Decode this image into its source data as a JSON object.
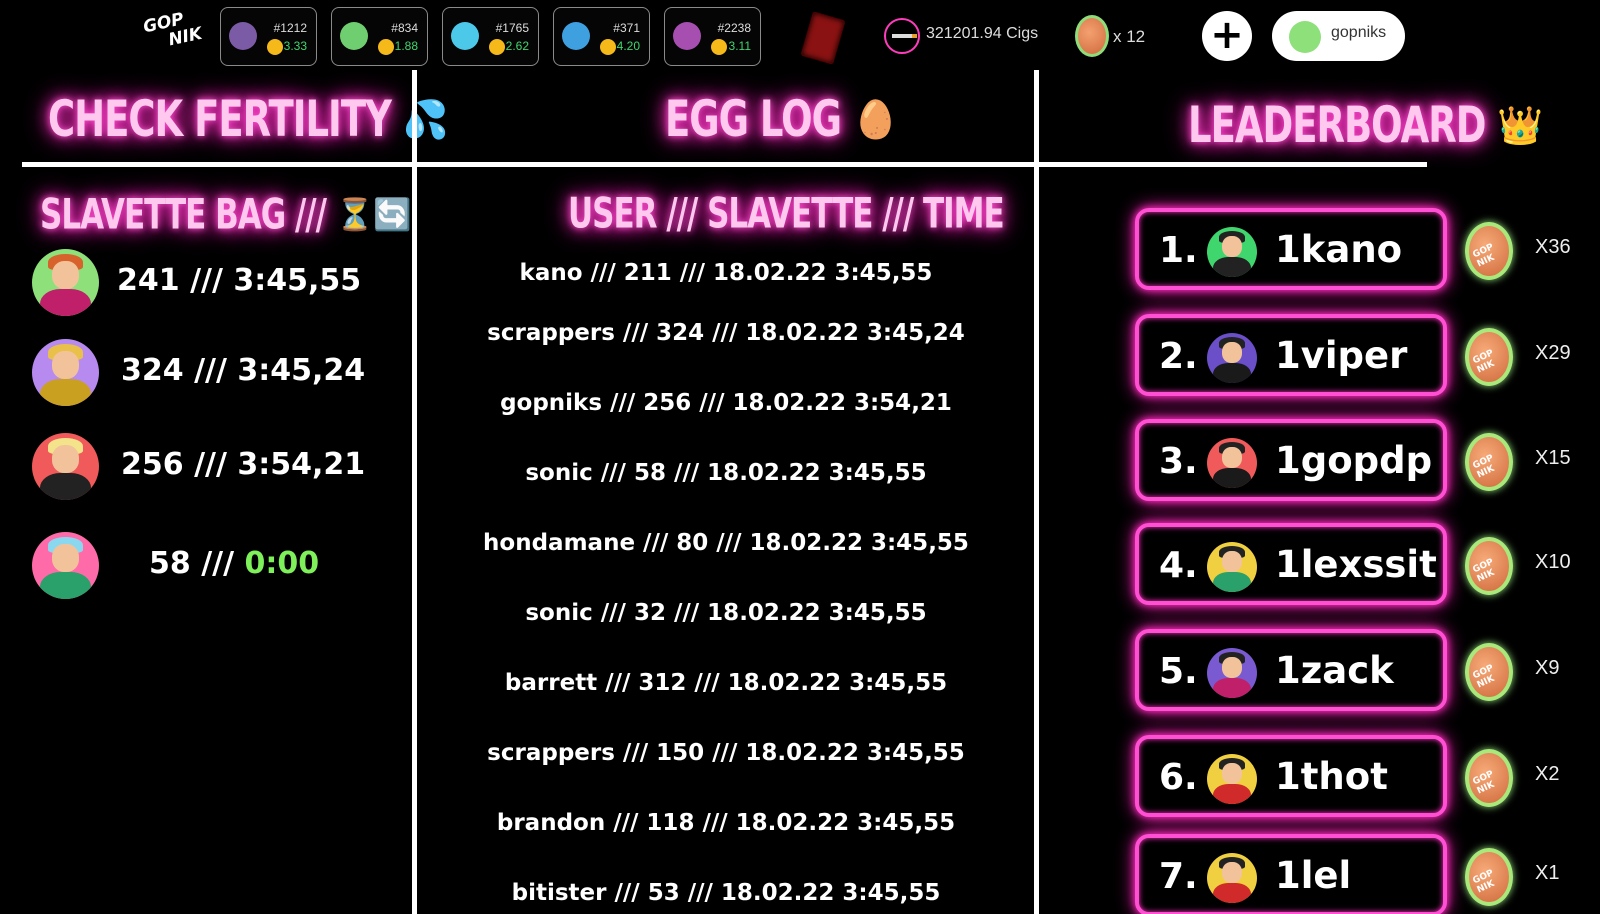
{
  "header": {
    "logo_line1": "GOP",
    "logo_line2": "NIK",
    "nfts": [
      {
        "id": "#1212",
        "value": "3.33",
        "bg": "#7b5aa6"
      },
      {
        "id": "#834",
        "value": "1.88",
        "bg": "#6fcf70"
      },
      {
        "id": "#1765",
        "value": "2.62",
        "bg": "#4cc8e8"
      },
      {
        "id": "#371",
        "value": "4.20",
        "bg": "#3fa0e0"
      },
      {
        "id": "#2238",
        "value": "3.11",
        "bg": "#a64fb0"
      }
    ],
    "cigs": "321201.94 Cigs",
    "eggs": "x 12",
    "plus_label": "+",
    "username": "gopniks"
  },
  "columns": {
    "fertility_title": "CHECK FERTILITY",
    "fertility_emoji": "💦",
    "egg_log_title": "EGG LOG",
    "egg_log_emoji": "🥚",
    "leaderboard_title": "LEADERBOARD",
    "leaderboard_emoji": "👑"
  },
  "bag": {
    "title": "SLAVETTE BAG ///",
    "title_emoji": "⏳🔄",
    "items": [
      {
        "id": "241",
        "sep": " /// ",
        "time": "3:45,55",
        "bg": "#8ee07a",
        "hair": "#d8622c",
        "outfit": "#c0206a"
      },
      {
        "id": "324",
        "sep": " /// ",
        "time": "3:45,24",
        "bg": "#b78af0",
        "hair": "#e8c04a",
        "outfit": "#c9a020"
      },
      {
        "id": "256",
        "sep": " /// ",
        "time": "3:54,21",
        "bg": "#f05a5a",
        "hair": "#f3e38a",
        "outfit": "#222222"
      },
      {
        "id": "58",
        "sep": " /// ",
        "time": "0:00",
        "bg": "#ff6aa8",
        "hair": "#8ad8f0",
        "outfit": "#2aa06a"
      }
    ]
  },
  "egg_log": {
    "header": "USER /// SLAVETTE /// TIME",
    "rows": [
      "kano /// 211 /// 18.02.22 3:45,55",
      "scrappers /// 324 /// 18.02.22 3:45,24",
      "gopniks /// 256 /// 18.02.22 3:54,21",
      "sonic /// 58 /// 18.02.22 3:45,55",
      "hondamane /// 80 /// 18.02.22 3:45,55",
      "sonic /// 32 /// 18.02.22 3:45,55",
      "barrett /// 312 /// 18.02.22 3:45,55",
      "scrappers /// 150 /// 18.02.22 3:45,55",
      "brandon /// 118 /// 18.02.22 3:45,55",
      "bitister /// 53 /// 18.02.22 3:45,55"
    ]
  },
  "leaderboard": {
    "egg_label": "GOP NIK",
    "rows": [
      {
        "rank": "1.",
        "name": "1kano",
        "count": "X36",
        "bg": "#3fd66e",
        "outfit": "#222222"
      },
      {
        "rank": "2.",
        "name": "1viper",
        "count": "X29",
        "bg": "#6a4fc8",
        "outfit": "#1a1a1a"
      },
      {
        "rank": "3.",
        "name": "1gopdp",
        "count": "X15",
        "bg": "#f05a5a",
        "outfit": "#1a1a1a"
      },
      {
        "rank": "4.",
        "name": "1lexssit",
        "count": "X10",
        "bg": "#f0d040",
        "outfit": "#2aa06a"
      },
      {
        "rank": "5.",
        "name": "1zack",
        "count": "X9",
        "bg": "#7a5ad0",
        "outfit": "#c0206a"
      },
      {
        "rank": "6.",
        "name": "1thot",
        "count": "X2",
        "bg": "#f0d040",
        "outfit": "#d02a2a"
      },
      {
        "rank": "7.",
        "name": "1lel",
        "count": "X1",
        "bg": "#f0d040",
        "outfit": "#d02a2a"
      }
    ]
  }
}
